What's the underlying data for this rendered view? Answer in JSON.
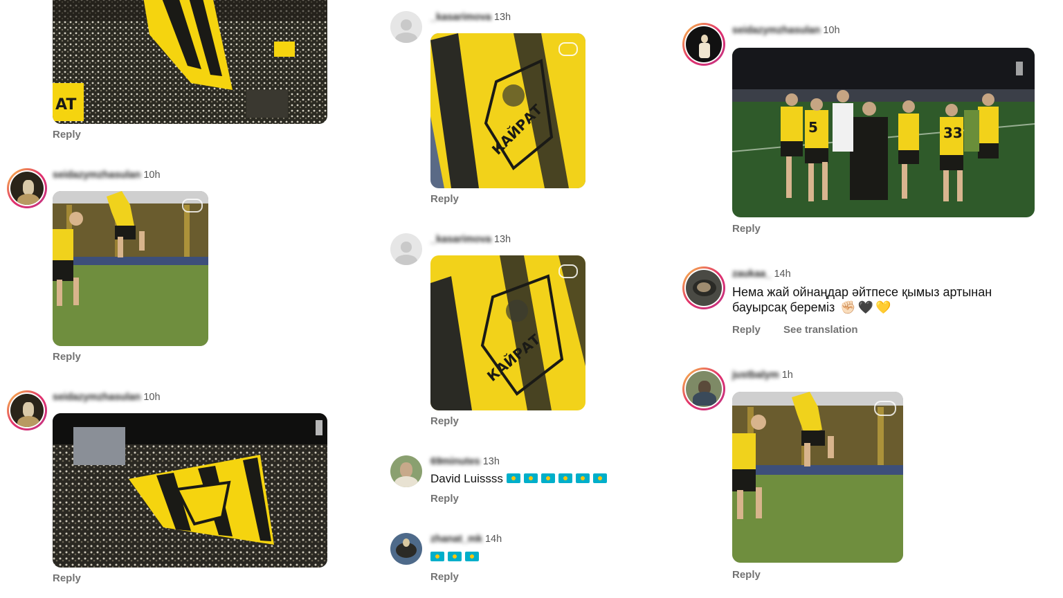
{
  "comments": [
    {
      "id": "c1",
      "username": "seidazymzhasulan",
      "time": "",
      "reply_label": "Reply"
    },
    {
      "id": "c2",
      "username": "seidazymzhasulan",
      "time": "10h",
      "reply_label": "Reply"
    },
    {
      "id": "c3",
      "username": "seidazymzhasulan",
      "time": "10h",
      "reply_label": "Reply"
    },
    {
      "id": "c4",
      "username": "_kasarimova",
      "time": "13h",
      "reply_label": "Reply"
    },
    {
      "id": "c5",
      "username": "_kasarimova",
      "time": "13h",
      "reply_label": "Reply"
    },
    {
      "id": "c6",
      "username": "69minutes",
      "time": "13h",
      "text": "David Luissss",
      "reply_label": "Reply"
    },
    {
      "id": "c7",
      "username": "zhanat_mk",
      "time": "14h",
      "reply_label": "Reply"
    },
    {
      "id": "c8",
      "username": "seidazymzhasulan",
      "time": "10h",
      "reply_label": "Reply"
    },
    {
      "id": "c9",
      "username": "zaukaa_",
      "time": "14h",
      "text_line1": "Нема жай ойнаңдар әйтпесе қымыз артынан",
      "text_line2": "бауырсақ береміз",
      "reply_label": "Reply",
      "translation_label": "See translation"
    },
    {
      "id": "c10",
      "username": "justbalym",
      "time": "1h",
      "reply_label": "Reply"
    }
  ],
  "emoji": {
    "flag": "kazakhstan-flag",
    "fist": "✊🏻",
    "black_heart": "🖤",
    "yellow_heart": "💛"
  },
  "colors": {
    "kairat_yellow": "#f5d40f",
    "kairat_black": "#1a1a16",
    "pitch_green": "#3f7a33",
    "meta_grey": "#737373"
  }
}
